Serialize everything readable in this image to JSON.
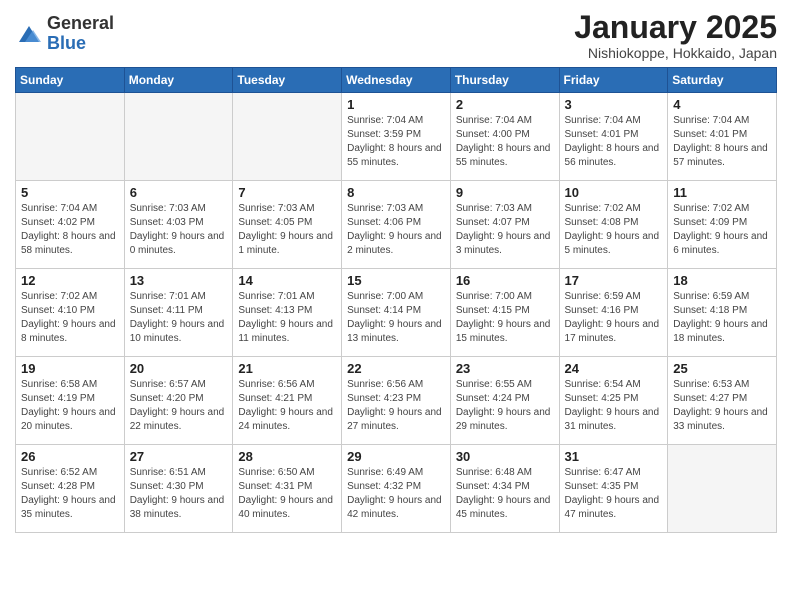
{
  "logo": {
    "general": "General",
    "blue": "Blue"
  },
  "header": {
    "month": "January 2025",
    "location": "Nishiokoppe, Hokkaido, Japan"
  },
  "weekdays": [
    "Sunday",
    "Monday",
    "Tuesday",
    "Wednesday",
    "Thursday",
    "Friday",
    "Saturday"
  ],
  "weeks": [
    [
      {
        "day": "",
        "empty": true
      },
      {
        "day": "",
        "empty": true
      },
      {
        "day": "",
        "empty": true
      },
      {
        "day": "1",
        "sunrise": "7:04 AM",
        "sunset": "3:59 PM",
        "daylight": "8 hours and 55 minutes."
      },
      {
        "day": "2",
        "sunrise": "7:04 AM",
        "sunset": "4:00 PM",
        "daylight": "8 hours and 55 minutes."
      },
      {
        "day": "3",
        "sunrise": "7:04 AM",
        "sunset": "4:01 PM",
        "daylight": "8 hours and 56 minutes."
      },
      {
        "day": "4",
        "sunrise": "7:04 AM",
        "sunset": "4:01 PM",
        "daylight": "8 hours and 57 minutes."
      }
    ],
    [
      {
        "day": "5",
        "sunrise": "7:04 AM",
        "sunset": "4:02 PM",
        "daylight": "8 hours and 58 minutes."
      },
      {
        "day": "6",
        "sunrise": "7:03 AM",
        "sunset": "4:03 PM",
        "daylight": "9 hours and 0 minutes."
      },
      {
        "day": "7",
        "sunrise": "7:03 AM",
        "sunset": "4:05 PM",
        "daylight": "9 hours and 1 minute."
      },
      {
        "day": "8",
        "sunrise": "7:03 AM",
        "sunset": "4:06 PM",
        "daylight": "9 hours and 2 minutes."
      },
      {
        "day": "9",
        "sunrise": "7:03 AM",
        "sunset": "4:07 PM",
        "daylight": "9 hours and 3 minutes."
      },
      {
        "day": "10",
        "sunrise": "7:02 AM",
        "sunset": "4:08 PM",
        "daylight": "9 hours and 5 minutes."
      },
      {
        "day": "11",
        "sunrise": "7:02 AM",
        "sunset": "4:09 PM",
        "daylight": "9 hours and 6 minutes."
      }
    ],
    [
      {
        "day": "12",
        "sunrise": "7:02 AM",
        "sunset": "4:10 PM",
        "daylight": "9 hours and 8 minutes."
      },
      {
        "day": "13",
        "sunrise": "7:01 AM",
        "sunset": "4:11 PM",
        "daylight": "9 hours and 10 minutes."
      },
      {
        "day": "14",
        "sunrise": "7:01 AM",
        "sunset": "4:13 PM",
        "daylight": "9 hours and 11 minutes."
      },
      {
        "day": "15",
        "sunrise": "7:00 AM",
        "sunset": "4:14 PM",
        "daylight": "9 hours and 13 minutes."
      },
      {
        "day": "16",
        "sunrise": "7:00 AM",
        "sunset": "4:15 PM",
        "daylight": "9 hours and 15 minutes."
      },
      {
        "day": "17",
        "sunrise": "6:59 AM",
        "sunset": "4:16 PM",
        "daylight": "9 hours and 17 minutes."
      },
      {
        "day": "18",
        "sunrise": "6:59 AM",
        "sunset": "4:18 PM",
        "daylight": "9 hours and 18 minutes."
      }
    ],
    [
      {
        "day": "19",
        "sunrise": "6:58 AM",
        "sunset": "4:19 PM",
        "daylight": "9 hours and 20 minutes."
      },
      {
        "day": "20",
        "sunrise": "6:57 AM",
        "sunset": "4:20 PM",
        "daylight": "9 hours and 22 minutes."
      },
      {
        "day": "21",
        "sunrise": "6:56 AM",
        "sunset": "4:21 PM",
        "daylight": "9 hours and 24 minutes."
      },
      {
        "day": "22",
        "sunrise": "6:56 AM",
        "sunset": "4:23 PM",
        "daylight": "9 hours and 27 minutes."
      },
      {
        "day": "23",
        "sunrise": "6:55 AM",
        "sunset": "4:24 PM",
        "daylight": "9 hours and 29 minutes."
      },
      {
        "day": "24",
        "sunrise": "6:54 AM",
        "sunset": "4:25 PM",
        "daylight": "9 hours and 31 minutes."
      },
      {
        "day": "25",
        "sunrise": "6:53 AM",
        "sunset": "4:27 PM",
        "daylight": "9 hours and 33 minutes."
      }
    ],
    [
      {
        "day": "26",
        "sunrise": "6:52 AM",
        "sunset": "4:28 PM",
        "daylight": "9 hours and 35 minutes."
      },
      {
        "day": "27",
        "sunrise": "6:51 AM",
        "sunset": "4:30 PM",
        "daylight": "9 hours and 38 minutes."
      },
      {
        "day": "28",
        "sunrise": "6:50 AM",
        "sunset": "4:31 PM",
        "daylight": "9 hours and 40 minutes."
      },
      {
        "day": "29",
        "sunrise": "6:49 AM",
        "sunset": "4:32 PM",
        "daylight": "9 hours and 42 minutes."
      },
      {
        "day": "30",
        "sunrise": "6:48 AM",
        "sunset": "4:34 PM",
        "daylight": "9 hours and 45 minutes."
      },
      {
        "day": "31",
        "sunrise": "6:47 AM",
        "sunset": "4:35 PM",
        "daylight": "9 hours and 47 minutes."
      },
      {
        "day": "",
        "empty": true
      }
    ]
  ],
  "labels": {
    "sunrise": "Sunrise:",
    "sunset": "Sunset:",
    "daylight": "Daylight:"
  }
}
